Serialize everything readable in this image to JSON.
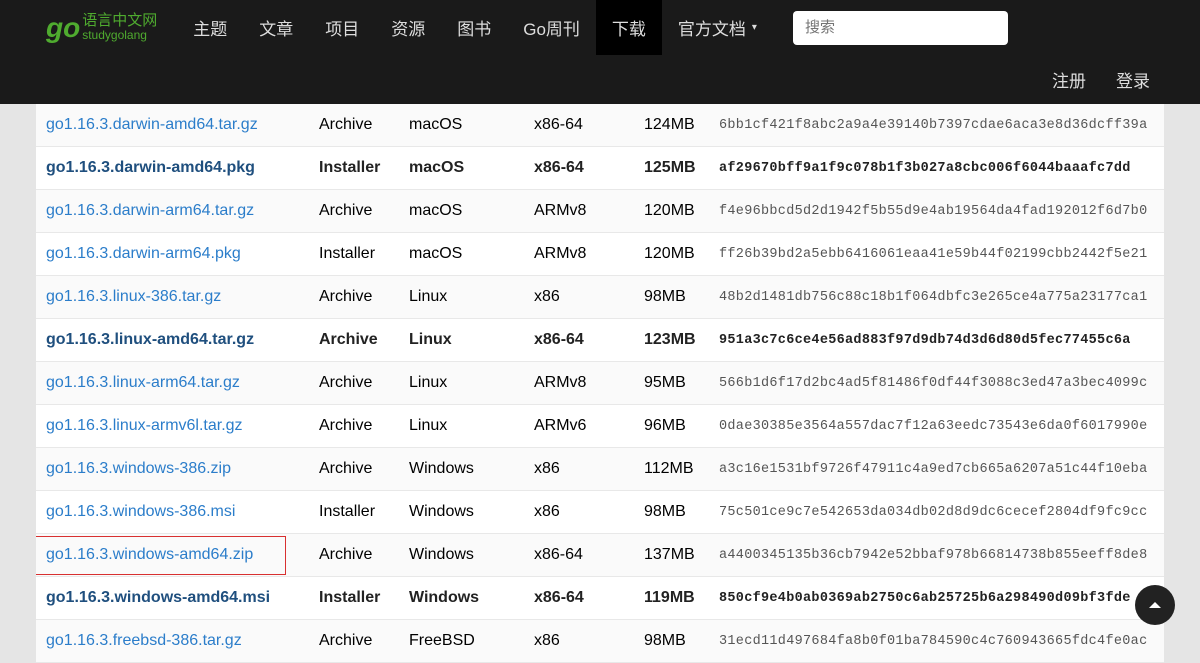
{
  "logo": {
    "go": "go",
    "cn": "语言中文网",
    "en": "studygolang"
  },
  "nav": {
    "items": [
      {
        "label": "主题",
        "active": false
      },
      {
        "label": "文章",
        "active": false
      },
      {
        "label": "项目",
        "active": false
      },
      {
        "label": "资源",
        "active": false
      },
      {
        "label": "图书",
        "active": false
      },
      {
        "label": "Go周刊",
        "active": false
      },
      {
        "label": "下载",
        "active": true
      },
      {
        "label": "官方文档",
        "active": false,
        "dropdown": true
      }
    ],
    "search_placeholder": "搜索",
    "register": "注册",
    "login": "登录"
  },
  "downloads": {
    "rows": [
      {
        "file": "go1.16.3.darwin-amd64.tar.gz",
        "kind": "Archive",
        "os": "macOS",
        "arch": "x86-64",
        "size": "124MB",
        "sha": "6bb1cf421f8abc2a9a4e39140b7397cdae6aca3e8d36dcff39a",
        "bold": false
      },
      {
        "file": "go1.16.3.darwin-amd64.pkg",
        "kind": "Installer",
        "os": "macOS",
        "arch": "x86-64",
        "size": "125MB",
        "sha": "af29670bff9a1f9c078b1f3b027a8cbc006f6044baaafc7dd",
        "bold": true
      },
      {
        "file": "go1.16.3.darwin-arm64.tar.gz",
        "kind": "Archive",
        "os": "macOS",
        "arch": "ARMv8",
        "size": "120MB",
        "sha": "f4e96bbcd5d2d1942f5b55d9e4ab19564da4fad192012f6d7b0",
        "bold": false
      },
      {
        "file": "go1.16.3.darwin-arm64.pkg",
        "kind": "Installer",
        "os": "macOS",
        "arch": "ARMv8",
        "size": "120MB",
        "sha": "ff26b39bd2a5ebb6416061eaa41e59b44f02199cbb2442f5e21",
        "bold": false
      },
      {
        "file": "go1.16.3.linux-386.tar.gz",
        "kind": "Archive",
        "os": "Linux",
        "arch": "x86",
        "size": "98MB",
        "sha": "48b2d1481db756c88c18b1f064dbfc3e265ce4a775a23177ca1",
        "bold": false
      },
      {
        "file": "go1.16.3.linux-amd64.tar.gz",
        "kind": "Archive",
        "os": "Linux",
        "arch": "x86-64",
        "size": "123MB",
        "sha": "951a3c7c6ce4e56ad883f97d9db74d3d6d80d5fec77455c6a",
        "bold": true
      },
      {
        "file": "go1.16.3.linux-arm64.tar.gz",
        "kind": "Archive",
        "os": "Linux",
        "arch": "ARMv8",
        "size": "95MB",
        "sha": "566b1d6f17d2bc4ad5f81486f0df44f3088c3ed47a3bec4099c",
        "bold": false
      },
      {
        "file": "go1.16.3.linux-armv6l.tar.gz",
        "kind": "Archive",
        "os": "Linux",
        "arch": "ARMv6",
        "size": "96MB",
        "sha": "0dae30385e3564a557dac7f12a63eedc73543e6da0f6017990e",
        "bold": false
      },
      {
        "file": "go1.16.3.windows-386.zip",
        "kind": "Archive",
        "os": "Windows",
        "arch": "x86",
        "size": "112MB",
        "sha": "a3c16e1531bf9726f47911c4a9ed7cb665a6207a51c44f10eba",
        "bold": false
      },
      {
        "file": "go1.16.3.windows-386.msi",
        "kind": "Installer",
        "os": "Windows",
        "arch": "x86",
        "size": "98MB",
        "sha": "75c501ce9c7e542653da034db02d8d9dc6cecef2804df9fc9cc",
        "bold": false
      },
      {
        "file": "go1.16.3.windows-amd64.zip",
        "kind": "Archive",
        "os": "Windows",
        "arch": "x86-64",
        "size": "137MB",
        "sha": "a4400345135b36cb7942e52bbaf978b66814738b855eeff8de8",
        "bold": false,
        "highlighted": true
      },
      {
        "file": "go1.16.3.windows-amd64.msi",
        "kind": "Installer",
        "os": "Windows",
        "arch": "x86-64",
        "size": "119MB",
        "sha": "850cf9e4b0ab0369ab2750c6ab25725b6a298490d09bf3fde",
        "bold": true
      },
      {
        "file": "go1.16.3.freebsd-386.tar.gz",
        "kind": "Archive",
        "os": "FreeBSD",
        "arch": "x86",
        "size": "98MB",
        "sha": "31ecd11d497684fa8b0f01ba784590c4c760943665fdc4fe0ac",
        "bold": false
      }
    ]
  }
}
